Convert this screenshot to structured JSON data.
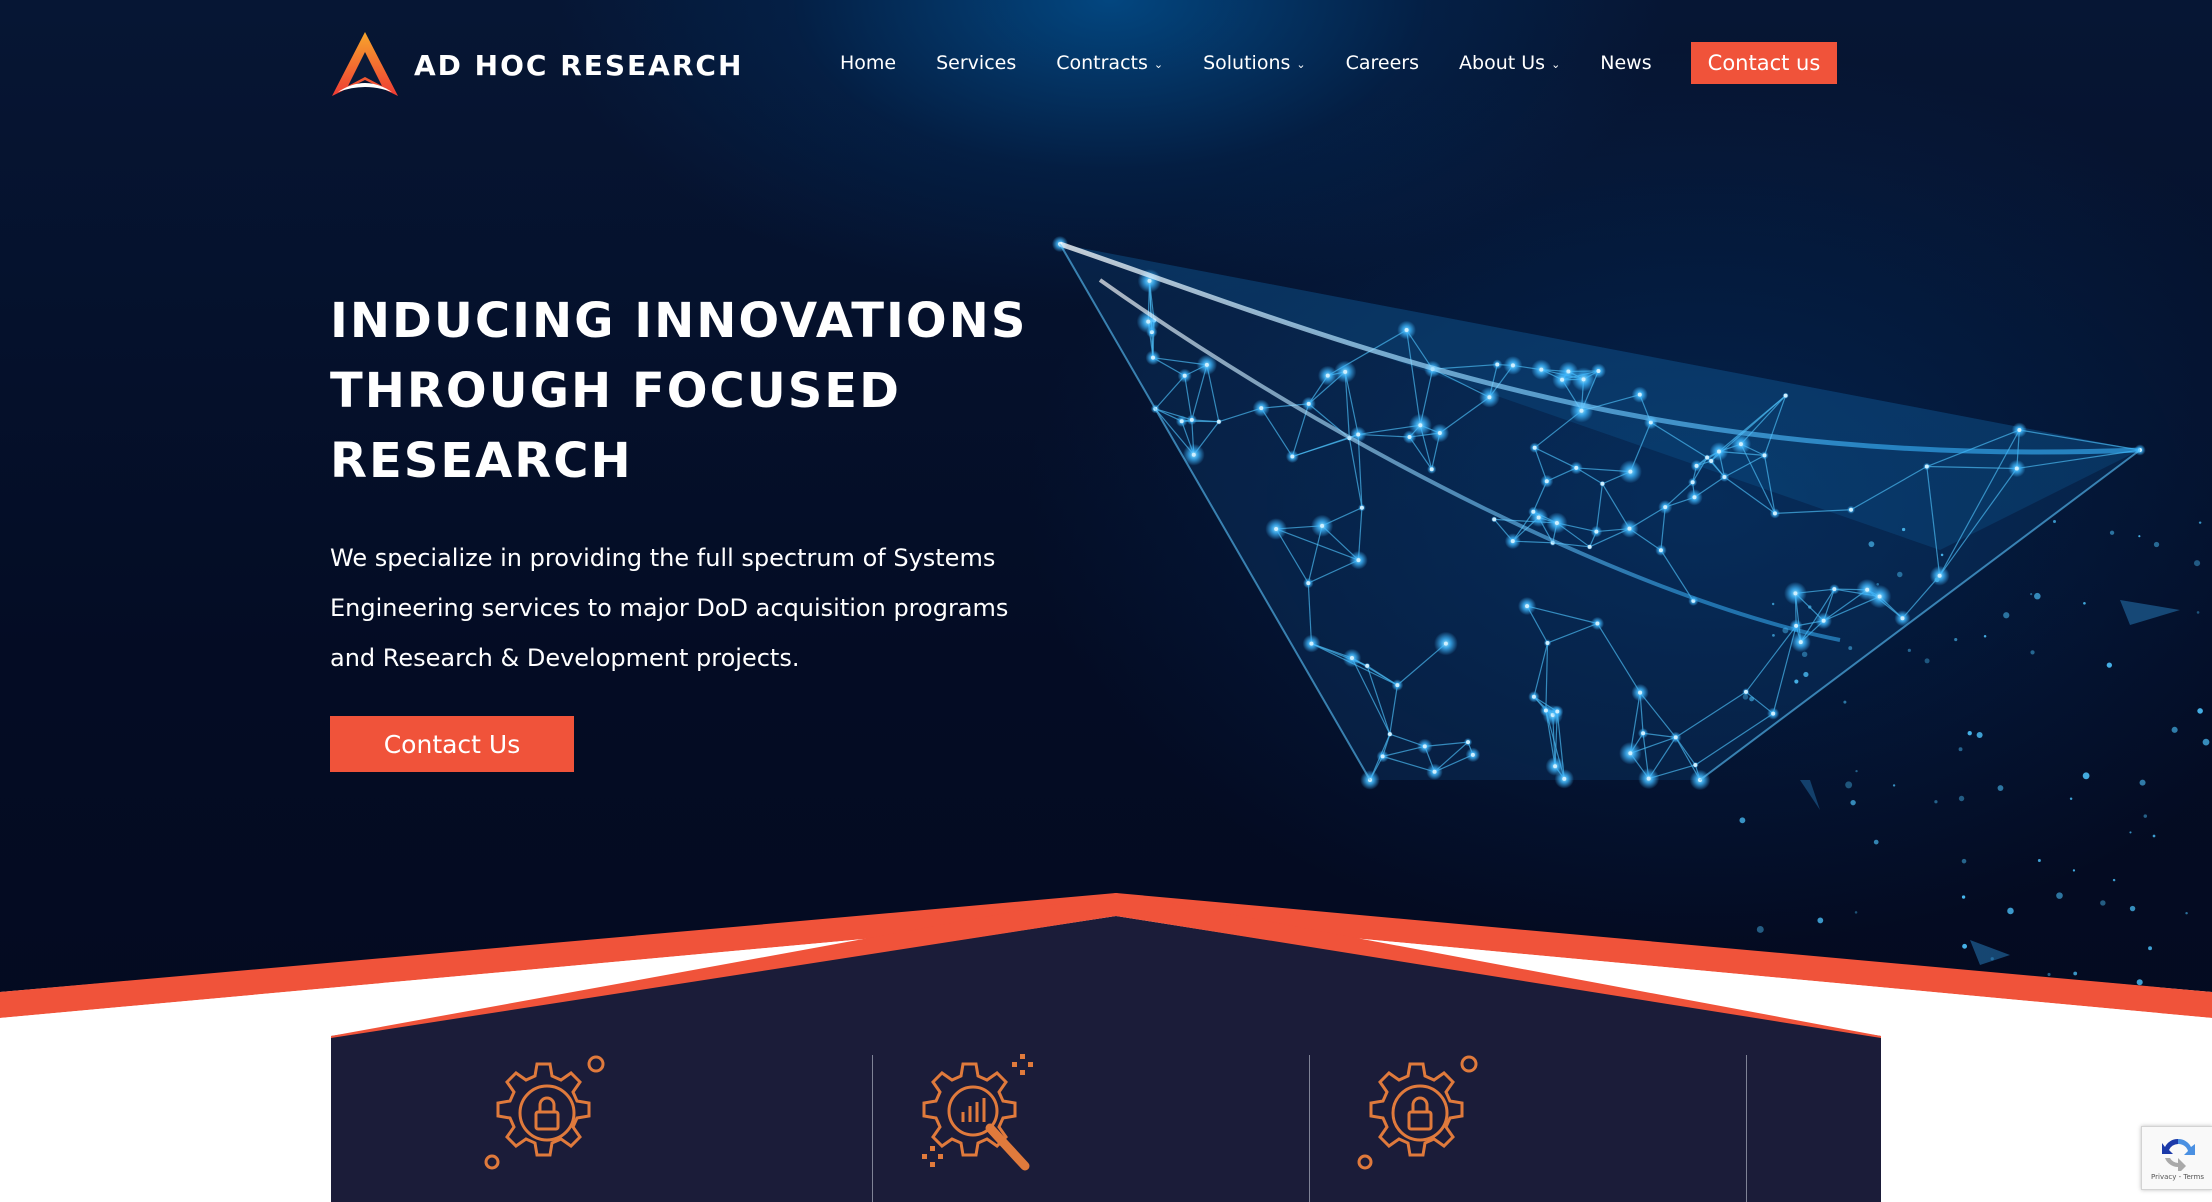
{
  "brand": {
    "name": "AD HOC RESEARCH",
    "accent": "#f0533a",
    "navy": "#1b1c39",
    "icon_orange": "#e07a3c"
  },
  "nav": {
    "items": [
      {
        "label": "Home",
        "has_dropdown": false
      },
      {
        "label": "Services",
        "has_dropdown": false
      },
      {
        "label": "Contracts",
        "has_dropdown": true
      },
      {
        "label": "Solutions",
        "has_dropdown": true
      },
      {
        "label": "Careers",
        "has_dropdown": false
      },
      {
        "label": "About Us",
        "has_dropdown": true
      },
      {
        "label": "News",
        "has_dropdown": false
      }
    ],
    "cta_label": "Contact us"
  },
  "hero": {
    "headline_lines": [
      "INDUCING INNOVATIONS",
      "THROUGH FOCUSED",
      "RESEARCH"
    ],
    "subtext_lines": [
      "We specialize in providing the full spectrum of Systems",
      "Engineering services to major DoD acquisition programs",
      "and Research & Development projects."
    ],
    "cta_label": "Contact Us",
    "image": "paper-plane-network-illustration"
  },
  "features": {
    "icons": [
      "gear-lock-icon",
      "gear-magnifier-chart-icon",
      "gear-lock-icon"
    ]
  },
  "recaptcha": {
    "links": "Privacy - Terms"
  }
}
